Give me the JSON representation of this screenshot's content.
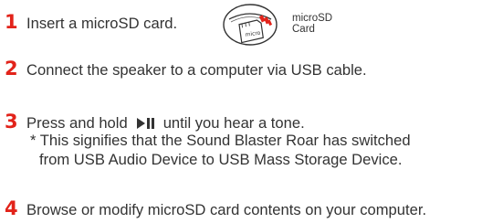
{
  "accent_color": "#e2231a",
  "steps": [
    {
      "number": "1",
      "text": "Insert a microSD card."
    },
    {
      "number": "2",
      "text": "Connect the speaker to a computer via USB cable."
    },
    {
      "number": "3",
      "text_before": "Press and hold",
      "icon": "play-pause-icon",
      "text_after": "until you hear a tone.",
      "note_line1": "* This signifies that the Sound Blaster Roar has switched",
      "note_line2": "from USB Audio Device to USB Mass Storage Device."
    },
    {
      "number": "4",
      "text": "Browse or modify microSD card contents on your computer."
    }
  ],
  "card_illustration": {
    "label_line1": "microSD",
    "label_line2": "Card"
  }
}
